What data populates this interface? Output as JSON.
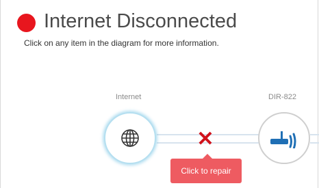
{
  "header": {
    "status_color": "#e8161e",
    "title": "Internet Disconnected",
    "subtitle": "Click on any item in the diagram for more information."
  },
  "diagram": {
    "internet": {
      "label": "Internet",
      "icon": "globe-icon"
    },
    "router": {
      "label": "DIR-822",
      "icon": "router-icon"
    },
    "connection": {
      "status_icon": "x-icon",
      "status_color": "#d0121b"
    },
    "repair": {
      "label": "Click to repair",
      "color": "#ee5b61"
    }
  }
}
